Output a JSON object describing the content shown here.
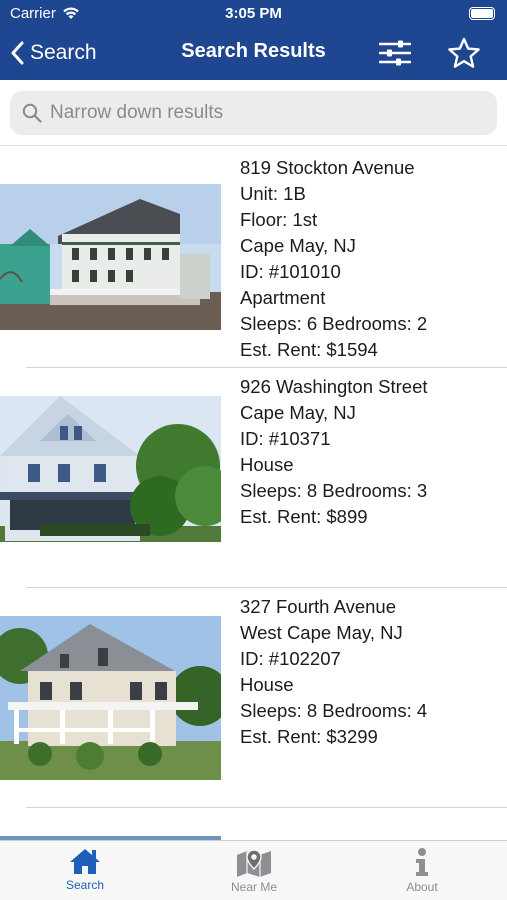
{
  "status_bar": {
    "carrier": "Carrier",
    "time": "3:05 PM"
  },
  "nav": {
    "back_label": "Search",
    "title": "Search Results",
    "filter_icon": "sliders-icon",
    "favorite_icon": "star-outline-icon",
    "background": "#1f4690"
  },
  "search": {
    "placeholder": "Narrow down results",
    "value": ""
  },
  "listings": [
    {
      "lines": [
        "819 Stockton Avenue",
        "Unit: 1B",
        "Floor: 1st",
        "Cape May, NJ",
        "ID: #101010",
        "Apartment",
        "Sleeps: 6 Bedrooms: 2",
        "Est. Rent: $1594"
      ]
    },
    {
      "lines": [
        "926 Washington Street",
        "Cape May, NJ",
        "ID: #10371",
        "House",
        "Sleeps: 8 Bedrooms: 3",
        "Est. Rent: $899"
      ]
    },
    {
      "lines": [
        "327 Fourth Avenue",
        "West Cape May, NJ",
        "ID: #102207",
        "House",
        "Sleeps: 8 Bedrooms: 4",
        "Est. Rent: $3299"
      ]
    }
  ],
  "tabbar": {
    "tabs": [
      {
        "label": "Search",
        "icon": "house-icon",
        "active": true
      },
      {
        "label": "Near Me",
        "icon": "map-pin-icon",
        "active": false
      },
      {
        "label": "About",
        "icon": "info-icon",
        "active": false
      }
    ],
    "active_color": "#1f5fb8",
    "inactive_color": "#8e8e93"
  }
}
